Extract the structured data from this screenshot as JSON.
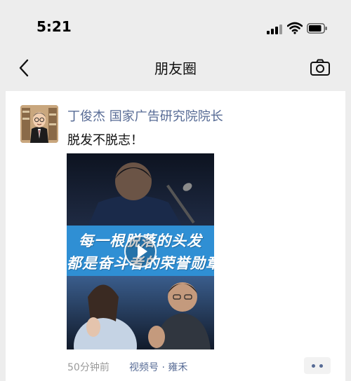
{
  "status_bar": {
    "time": "5:21"
  },
  "nav": {
    "title": "朋友圈"
  },
  "post": {
    "author": "丁俊杰 国家广告研究院院长",
    "text": "脱发不脱志！",
    "video": {
      "banner_line1": "每一根脱落的头发",
      "banner_line2": "都是奋斗者的荣誉勋章"
    },
    "time_ago": "50分钟前",
    "source": "视频号 · 雍禾"
  },
  "colors": {
    "link": "#576b95",
    "background": "#ededed",
    "card": "#ffffff",
    "banner": "#2f8fd4"
  },
  "icons": [
    "back-icon",
    "camera-icon",
    "signal-icon",
    "wifi-icon",
    "battery-icon",
    "play-icon",
    "more-icon"
  ]
}
